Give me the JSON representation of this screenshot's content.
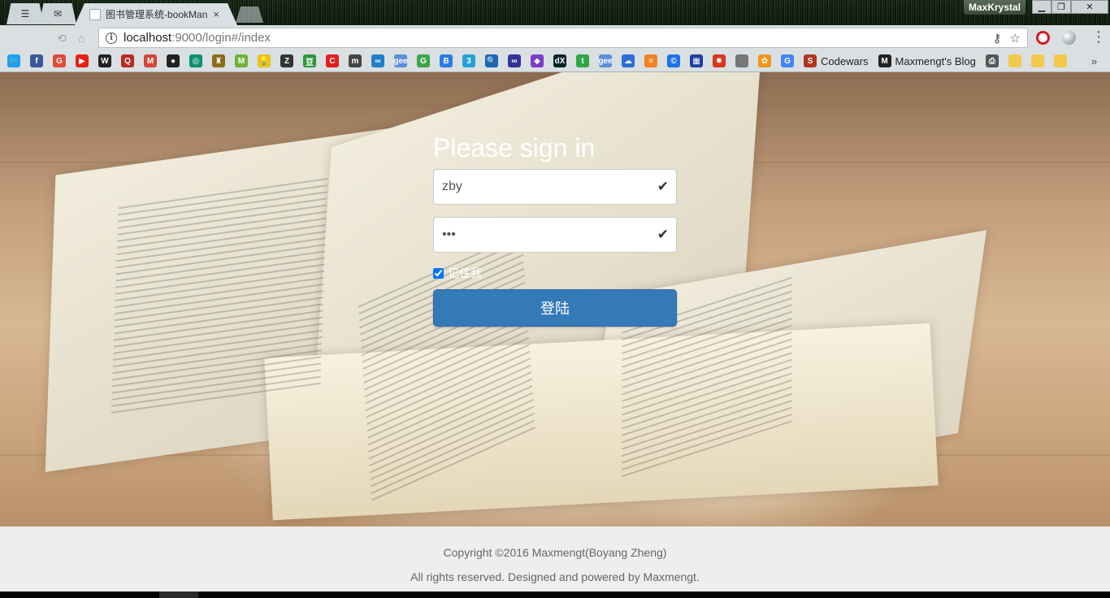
{
  "browser": {
    "profile_name": "MaxKrystal",
    "tab": {
      "title": "图书管理系统-bookManager",
      "close": "×"
    },
    "address": {
      "host": "localhost",
      "rest": ":9000/login#/index"
    },
    "window_controls": {
      "minimize": "▁",
      "maximize": "❐",
      "close": "✕"
    },
    "bookmarks": [
      {
        "icon": "twitter-icon",
        "color": "#1da1f2",
        "glyph": "🐦"
      },
      {
        "icon": "facebook-icon",
        "color": "#3b5998",
        "glyph": "f"
      },
      {
        "icon": "google-plus-icon",
        "color": "#dd4b39",
        "glyph": "G"
      },
      {
        "icon": "youtube-icon",
        "color": "#e62117",
        "glyph": "▶"
      },
      {
        "icon": "wikipedia-icon",
        "color": "#222",
        "glyph": "W"
      },
      {
        "icon": "quora-icon",
        "color": "#b92b27",
        "glyph": "Q"
      },
      {
        "icon": "gmail-icon",
        "color": "#d44638",
        "glyph": "M"
      },
      {
        "icon": "github-icon",
        "color": "#222",
        "glyph": "●"
      },
      {
        "icon": "circle-icon",
        "color": "#0b8f70",
        "glyph": "◎"
      },
      {
        "icon": "shield-icon",
        "color": "#8a6d1b",
        "glyph": "♜"
      },
      {
        "icon": "m-icon",
        "color": "#6fb23a",
        "glyph": "M"
      },
      {
        "icon": "bulb-icon",
        "color": "#e8c21d",
        "glyph": "💡"
      },
      {
        "icon": "slash-icon",
        "color": "#333",
        "glyph": "Z"
      },
      {
        "icon": "douban-icon",
        "color": "#2e963d",
        "glyph": "豆"
      },
      {
        "icon": "c-icon",
        "color": "#e21e1e",
        "glyph": "C"
      },
      {
        "icon": "medium-icon",
        "color": "#444",
        "glyph": "m"
      },
      {
        "icon": "infinity-icon",
        "color": "#1e7ec8",
        "glyph": "∞"
      },
      {
        "icon": "geek-icon",
        "color": "#5b8fd6",
        "glyph": "gee"
      },
      {
        "icon": "g-green-icon",
        "color": "#3ca54c",
        "glyph": "G"
      },
      {
        "icon": "b-icon",
        "color": "#2c7be5",
        "glyph": "B"
      },
      {
        "icon": "three-icon",
        "color": "#27a0d8",
        "glyph": "3"
      },
      {
        "icon": "magnifier-icon",
        "color": "#1a66b8",
        "glyph": "🔍"
      },
      {
        "icon": "link-icon",
        "color": "#333399",
        "glyph": "∞"
      },
      {
        "icon": "purple-icon",
        "color": "#7a3fc4",
        "glyph": "◆"
      },
      {
        "icon": "edx-icon",
        "color": "#02262b",
        "glyph": "dX"
      },
      {
        "icon": "t-icon",
        "color": "#2fa546",
        "glyph": "t"
      },
      {
        "icon": "gee-icon",
        "color": "#5b8fd6",
        "glyph": "gee"
      },
      {
        "icon": "cloud-icon",
        "color": "#2b6ed6",
        "glyph": "☁"
      },
      {
        "icon": "stack-icon",
        "color": "#f48024",
        "glyph": "≡"
      },
      {
        "icon": "circle-blue-icon",
        "color": "#1a73e8",
        "glyph": "©"
      },
      {
        "icon": "bars-icon",
        "color": "#1f3fa0",
        "glyph": "▦"
      },
      {
        "icon": "sun-icon",
        "color": "#d63a1d",
        "glyph": "✹"
      },
      {
        "icon": "apple-icon",
        "color": "#777",
        "glyph": ""
      },
      {
        "icon": "orange-icon",
        "color": "#f0961c",
        "glyph": "✿"
      },
      {
        "icon": "google-icon",
        "color": "#4285f4",
        "glyph": "G"
      }
    ],
    "bookmark_named": [
      {
        "icon": "codewars-icon",
        "color": "#b1361e",
        "glyph": "S",
        "label": "Codewars"
      },
      {
        "icon": "maxmengt-icon",
        "color": "#222",
        "glyph": "M",
        "label": "Maxmengt's Blog"
      }
    ],
    "bookmark_tail": [
      {
        "icon": "printer-icon",
        "color": "#555",
        "glyph": "⎙"
      },
      {
        "icon": "folder-icon",
        "color": "#f2c94c",
        "glyph": ""
      },
      {
        "icon": "folder-icon",
        "color": "#f2c94c",
        "glyph": ""
      },
      {
        "icon": "folder-icon",
        "color": "#f2c94c",
        "glyph": ""
      }
    ],
    "bookmarks_more": "»"
  },
  "login": {
    "heading": "Please sign in",
    "username_value": "zby",
    "password_value": "•••",
    "remember_label": "记住我",
    "remember_checked": true,
    "submit_label": "登陆"
  },
  "footer": {
    "copyright": "Copyright ©2016 Maxmengt(Boyang Zheng)",
    "rights": "All rights reserved. Designed and powered by Maxmengt."
  },
  "colors": {
    "primary": "#337ab7",
    "footer_bg": "#eeeeee"
  }
}
